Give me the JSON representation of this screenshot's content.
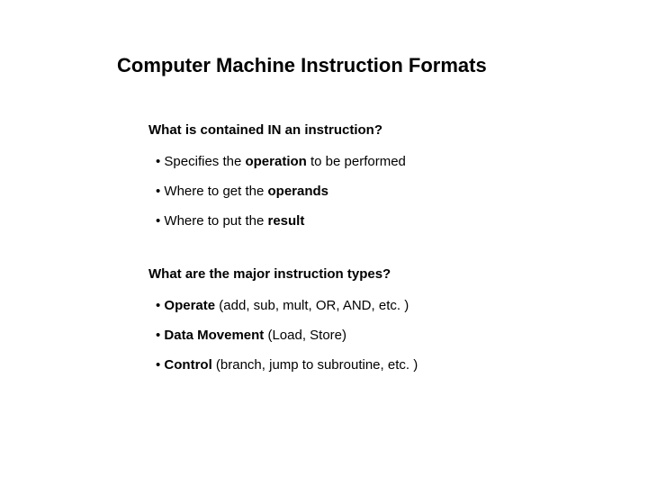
{
  "title": "Computer Machine Instruction Formats",
  "section1": {
    "question": "What is contained IN an instruction?",
    "items": [
      {
        "pre": "Specifies the ",
        "bold": "operation",
        "post": " to be performed"
      },
      {
        "pre": "Where to get the ",
        "bold": "operands",
        "post": ""
      },
      {
        "pre": "Where to put the ",
        "bold": "result",
        "post": ""
      }
    ]
  },
  "section2": {
    "question": "What are the major instruction types?",
    "items": [
      {
        "bold": "Operate",
        "post": " (add, sub, mult, OR, AND, etc. )"
      },
      {
        "bold": "Data Movement",
        "post": " (Load, Store)"
      },
      {
        "bold": "Control",
        "post": " (branch, jump to subroutine, etc. )"
      }
    ]
  }
}
